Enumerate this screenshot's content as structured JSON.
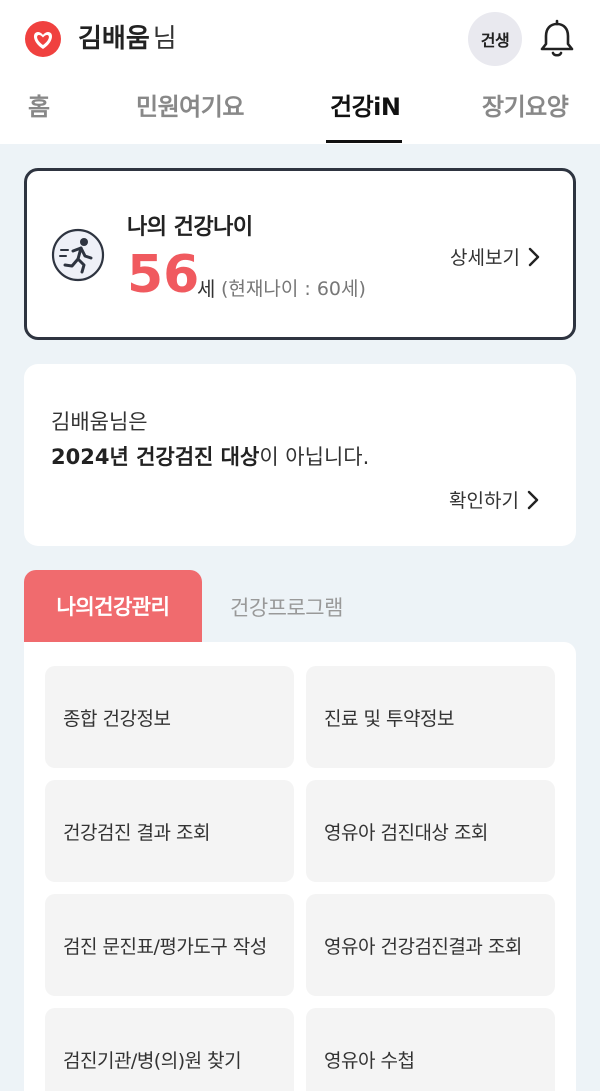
{
  "header": {
    "user_name": "김배움",
    "user_suffix": "님",
    "badge_label": "건생",
    "icons": {
      "logo": "heart-logo-icon",
      "bell": "bell-icon"
    }
  },
  "tabs": [
    {
      "label": "홈",
      "active": false
    },
    {
      "label": "민원여기요",
      "active": false
    },
    {
      "label": "건강iN",
      "active": true
    },
    {
      "label": "장기요양",
      "active": false
    }
  ],
  "health_age": {
    "label": "나의 건강나이",
    "value": "56",
    "unit": "세",
    "real_age": "(현재나이 : 60세)",
    "detail_link": "상세보기"
  },
  "checkup": {
    "line1": "김배움님은",
    "line2_bold": "2024년 건강검진 대상",
    "line2_rest": "이 아닙니다.",
    "confirm_link": "확인하기"
  },
  "sub_tabs": [
    {
      "label": "나의건강관리",
      "active": true
    },
    {
      "label": "건강프로그램",
      "active": false
    }
  ],
  "menu": [
    "종합 건강정보",
    "진료 및 투약정보",
    "건강검진 결과 조회",
    "영유아 검진대상 조회",
    "검진 문진표/평가도구 작성",
    "영유아 건강검진결과 조회",
    "검진기관/병(의)원 찾기",
    "영유아 수첩"
  ],
  "colors": {
    "accent": "#f05a5f",
    "tab_active_bg": "#f06b6e",
    "page_bg": "#edf3f7"
  }
}
